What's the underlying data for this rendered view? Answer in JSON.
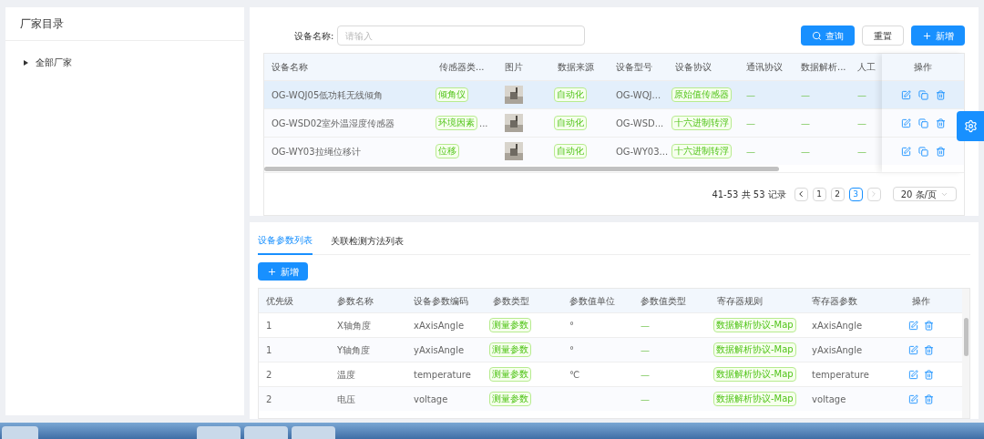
{
  "sidebar": {
    "title": "厂家目录",
    "tree": [
      {
        "label": "全部厂家",
        "expanded": false
      }
    ]
  },
  "search": {
    "label": "设备名称:",
    "placeholder": "请输入"
  },
  "buttons": [
    {
      "kind": "search",
      "label": "查询"
    },
    {
      "kind": "reset",
      "label": "重置"
    },
    {
      "kind": "add",
      "label": "新增"
    }
  ],
  "device_table": {
    "columns": [
      "设备名称",
      "传感器类...",
      "图片",
      "数据来源",
      "设备型号",
      "设备协议",
      "通讯协议",
      "数据解析...",
      "人工",
      "操作"
    ],
    "rows": [
      {
        "selected": true,
        "cells": [
          {
            "kind": "text",
            "text": "OG-WQJ05低功耗无线倾角"
          },
          {
            "kind": "tag",
            "text": "倾角仪"
          },
          {
            "kind": "picture"
          },
          {
            "kind": "tag",
            "text": "自动化"
          },
          {
            "kind": "text",
            "text": "OG-WQJ..."
          },
          {
            "kind": "tag",
            "text": "原始值传感器"
          },
          {
            "kind": "dash",
            "text": "—"
          },
          {
            "kind": "dash",
            "text": "—"
          },
          {
            "kind": "dash",
            "text": "—"
          }
        ]
      },
      {
        "selected": false,
        "cells": [
          {
            "kind": "text",
            "text": "OG-WSD02室外温湿度传感器"
          },
          {
            "kind": "tag",
            "text": "环境因素",
            "extra": "..."
          },
          {
            "kind": "picture"
          },
          {
            "kind": "tag",
            "text": "自动化"
          },
          {
            "kind": "text",
            "text": "OG-WSD..."
          },
          {
            "kind": "tag",
            "text": "十六进制转浮"
          },
          {
            "kind": "dash",
            "text": "—"
          },
          {
            "kind": "dash",
            "text": "—"
          },
          {
            "kind": "dash",
            "text": "—"
          }
        ]
      },
      {
        "selected": false,
        "cells": [
          {
            "kind": "text",
            "text": "OG-WY03拉绳位移计"
          },
          {
            "kind": "tag",
            "text": "位移"
          },
          {
            "kind": "picture"
          },
          {
            "kind": "tag",
            "text": "自动化"
          },
          {
            "kind": "text",
            "text": "OG-WY03..."
          },
          {
            "kind": "tag",
            "text": "十六进制转浮"
          },
          {
            "kind": "dash",
            "text": "—"
          },
          {
            "kind": "dash",
            "text": "—"
          },
          {
            "kind": "dash",
            "text": "—"
          }
        ]
      }
    ]
  },
  "pagination": {
    "summary": "41-53 共 53 记录",
    "pages": [
      {
        "label": "1",
        "selected": false
      },
      {
        "label": "2",
        "selected": false
      },
      {
        "label": "3",
        "selected": true
      }
    ],
    "page_size": "20 条/页"
  },
  "tabs": [
    {
      "label": "设备参数列表",
      "selected": true
    },
    {
      "label": "关联检测方法列表",
      "selected": false
    }
  ],
  "add_button": "新增",
  "param_table": {
    "columns": [
      "优先级",
      "参数名称",
      "设备参数编码",
      "参数类型",
      "参数值单位",
      "参数值类型",
      "寄存器规则",
      "寄存器参数",
      "操作"
    ],
    "rows": [
      {
        "cells": [
          {
            "kind": "text",
            "text": "1"
          },
          {
            "kind": "text",
            "text": "X轴角度"
          },
          {
            "kind": "text",
            "text": "xAxisAngle"
          },
          {
            "kind": "tag",
            "text": "测量参数"
          },
          {
            "kind": "text",
            "text": "°"
          },
          {
            "kind": "dash",
            "text": "—"
          },
          {
            "kind": "tag",
            "text": "数据解析协议-Map"
          },
          {
            "kind": "text",
            "text": "xAxisAngle"
          }
        ]
      },
      {
        "cells": [
          {
            "kind": "text",
            "text": "1"
          },
          {
            "kind": "text",
            "text": "Y轴角度"
          },
          {
            "kind": "text",
            "text": "yAxisAngle"
          },
          {
            "kind": "tag",
            "text": "测量参数"
          },
          {
            "kind": "text",
            "text": "°"
          },
          {
            "kind": "dash",
            "text": "—"
          },
          {
            "kind": "tag",
            "text": "数据解析协议-Map"
          },
          {
            "kind": "text",
            "text": "yAxisAngle"
          }
        ]
      },
      {
        "cells": [
          {
            "kind": "text",
            "text": "2"
          },
          {
            "kind": "text",
            "text": "温度"
          },
          {
            "kind": "text",
            "text": "temperature"
          },
          {
            "kind": "tag",
            "text": "测量参数"
          },
          {
            "kind": "text",
            "text": "℃"
          },
          {
            "kind": "dash",
            "text": "—"
          },
          {
            "kind": "tag",
            "text": "数据解析协议-Map"
          },
          {
            "kind": "text",
            "text": "temperature"
          }
        ]
      },
      {
        "cells": [
          {
            "kind": "text",
            "text": "2"
          },
          {
            "kind": "text",
            "text": "电压"
          },
          {
            "kind": "text",
            "text": "voltage"
          },
          {
            "kind": "tag",
            "text": "测量参数"
          },
          {
            "kind": "empty"
          },
          {
            "kind": "dash",
            "text": "—"
          },
          {
            "kind": "tag",
            "text": "数据解析协议-Map"
          },
          {
            "kind": "text",
            "text": "voltage"
          }
        ]
      }
    ]
  }
}
